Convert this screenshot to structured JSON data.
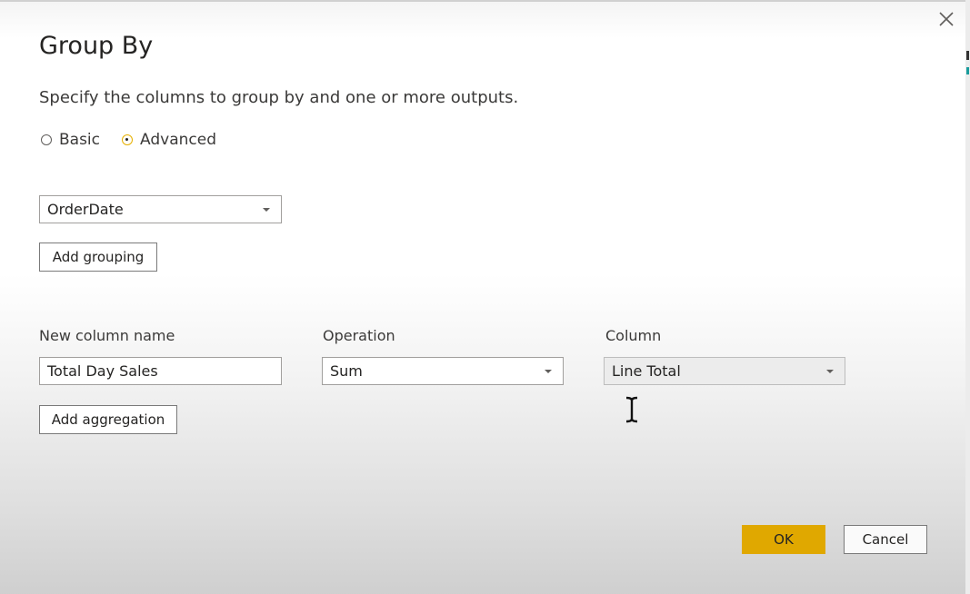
{
  "dialog": {
    "title": "Group By",
    "subtitle": "Specify the columns to group by and one or more outputs.",
    "mode_options": [
      {
        "label": "Basic",
        "selected": false
      },
      {
        "label": "Advanced",
        "selected": true
      }
    ],
    "grouping": {
      "column_value": "OrderDate",
      "add_grouping_label": "Add grouping"
    },
    "aggregation": {
      "new_column_label": "New column name",
      "new_column_value": "Total Day Sales",
      "operation_label": "Operation",
      "operation_value": "Sum",
      "column_label": "Column",
      "column_value": "Line Total",
      "add_aggregation_label": "Add aggregation"
    },
    "footer": {
      "ok_label": "OK",
      "cancel_label": "Cancel"
    },
    "icons": {
      "close": "close-icon",
      "dropdown": "chevron-down-icon",
      "cursor": "text-cursor-icon"
    },
    "colors": {
      "accent": "#e0a800",
      "text": "#252423"
    }
  }
}
